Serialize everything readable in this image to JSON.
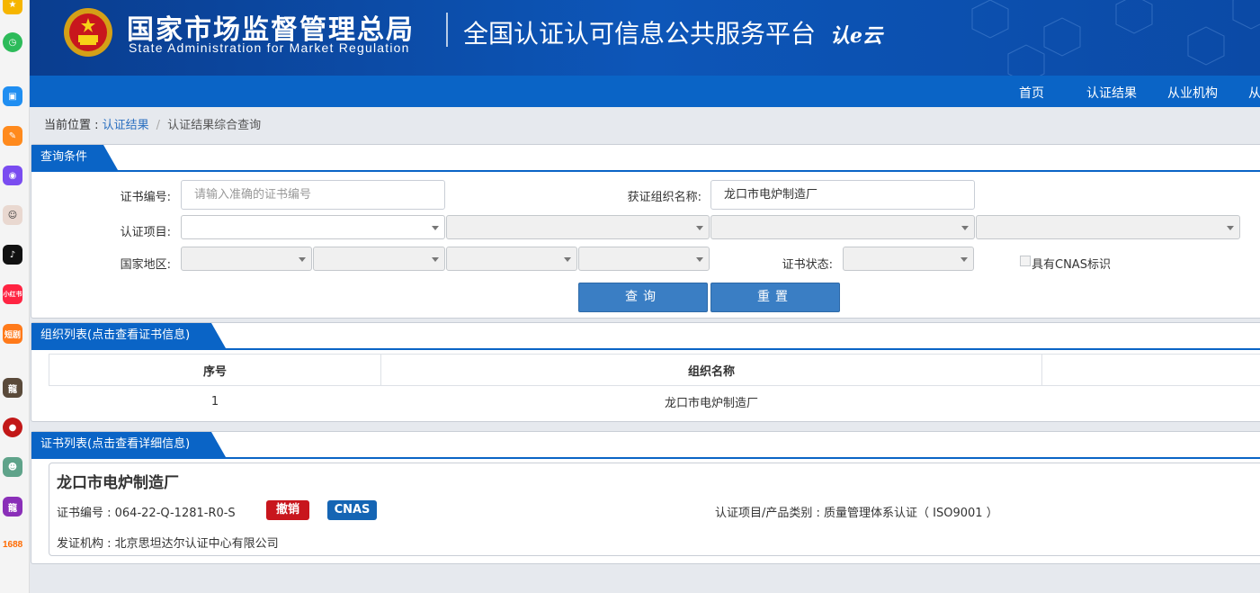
{
  "header": {
    "title_cn": "国家市场监督管理总局",
    "title_en": "State Administration  for  Market Regulation",
    "platform": "全国认证认可信息公共服务平台",
    "logo_text": "认e云"
  },
  "nav": {
    "items": [
      "首页",
      "认证结果",
      "从业机构",
      "从"
    ]
  },
  "breadcrumb": {
    "prefix": "当前位置 : ",
    "link": "认证结果",
    "separator": "/",
    "current": "认证结果综合查询"
  },
  "query": {
    "tab_label": "查询条件",
    "cert_no_label": "证书编号:",
    "cert_no_placeholder": "请输入准确的证书编号",
    "org_name_label": "获证组织名称:",
    "org_name_value": "龙口市电炉制造厂",
    "project_label": "认证项目:",
    "region_label": "国家地区:",
    "status_label": "证书状态:",
    "cnas_label": "具有CNAS标识",
    "search_button": "查询",
    "reset_button": "重置"
  },
  "org_list": {
    "tab_label": "组织列表(点击查看证书信息)",
    "columns": [
      "序号",
      "组织名称",
      ""
    ],
    "rows": [
      [
        "1",
        "龙口市电炉制造厂",
        ""
      ]
    ]
  },
  "cert_list": {
    "tab_label": "证书列表(点击查看详细信息)",
    "org_name": "龙口市电炉制造厂",
    "cert_no": "证书编号 : 064-22-Q-1281-R0-S",
    "status_badge": "撤销",
    "cnas_badge": "CNAS",
    "project": "认证项目/产品类别 : 质量管理体系认证（ ISO9001 ）",
    "issuer": "发证机构 : 北京思坦达尔认证中心有限公司"
  },
  "colors": {
    "header_bg": "#0d56b8",
    "nav_bg": "#0a64c6",
    "button_bg": "#3a7ec4",
    "revoked_badge": "#c8161d",
    "cnas_badge": "#1565b4"
  },
  "dock": {
    "bottom_label": "1688",
    "app_badges": [
      "小红书",
      "短剧"
    ]
  }
}
